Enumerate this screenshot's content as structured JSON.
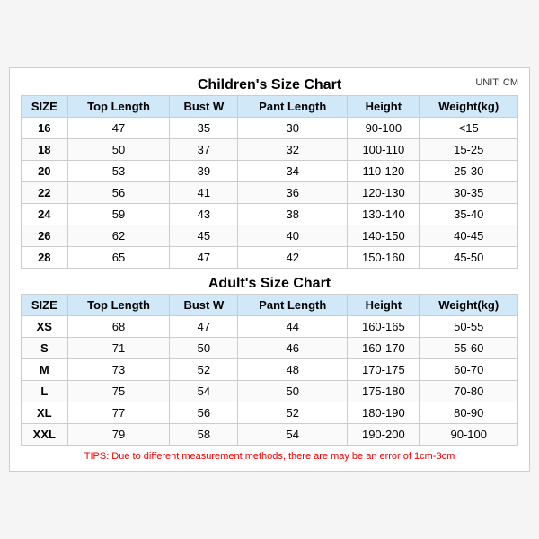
{
  "page": {
    "children_title": "Children's Size Chart",
    "adults_title": "Adult's Size Chart",
    "unit": "UNIT: CM",
    "tips": "TIPS: Due to different measurement methods, there are may be an error of 1cm-3cm",
    "headers": [
      "SIZE",
      "Top Length",
      "Bust W",
      "Pant Length",
      "Height",
      "Weight(kg)"
    ],
    "children_rows": [
      [
        "16",
        "47",
        "35",
        "30",
        "90-100",
        "<15"
      ],
      [
        "18",
        "50",
        "37",
        "32",
        "100-110",
        "15-25"
      ],
      [
        "20",
        "53",
        "39",
        "34",
        "110-120",
        "25-30"
      ],
      [
        "22",
        "56",
        "41",
        "36",
        "120-130",
        "30-35"
      ],
      [
        "24",
        "59",
        "43",
        "38",
        "130-140",
        "35-40"
      ],
      [
        "26",
        "62",
        "45",
        "40",
        "140-150",
        "40-45"
      ],
      [
        "28",
        "65",
        "47",
        "42",
        "150-160",
        "45-50"
      ]
    ],
    "adult_rows": [
      [
        "XS",
        "68",
        "47",
        "44",
        "160-165",
        "50-55"
      ],
      [
        "S",
        "71",
        "50",
        "46",
        "160-170",
        "55-60"
      ],
      [
        "M",
        "73",
        "52",
        "48",
        "170-175",
        "60-70"
      ],
      [
        "L",
        "75",
        "54",
        "50",
        "175-180",
        "70-80"
      ],
      [
        "XL",
        "77",
        "56",
        "52",
        "180-190",
        "80-90"
      ],
      [
        "XXL",
        "79",
        "58",
        "54",
        "190-200",
        "90-100"
      ]
    ]
  }
}
